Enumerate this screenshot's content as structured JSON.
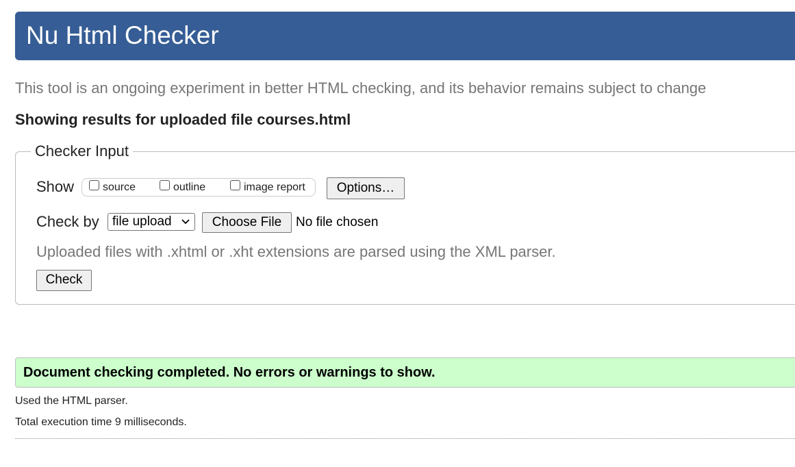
{
  "header": {
    "title": "Nu Html Checker",
    "background_color": "#365d95"
  },
  "tagline": "This tool is an ongoing experiment in better HTML checking, and its behavior remains subject to change",
  "results_heading": "Showing results for uploaded file courses.html",
  "checker_input": {
    "legend": "Checker Input",
    "show": {
      "label": "Show",
      "options": [
        {
          "label": "source",
          "checked": false
        },
        {
          "label": "outline",
          "checked": false
        },
        {
          "label": "image report",
          "checked": false
        }
      ],
      "options_button": "Options…"
    },
    "check_by": {
      "label": "Check by",
      "selected": "file upload",
      "choose_file_button": "Choose File",
      "file_status": "No file chosen"
    },
    "note": "Uploaded files with .xhtml or .xht extensions are parsed using the XML parser.",
    "check_button": "Check"
  },
  "result": {
    "message": "Document checking completed. No errors or warnings to show.",
    "background_color": "#ccffcc"
  },
  "footer_info": {
    "parser": "Used the HTML parser.",
    "execution_time": "Total execution time 9 milliseconds."
  }
}
